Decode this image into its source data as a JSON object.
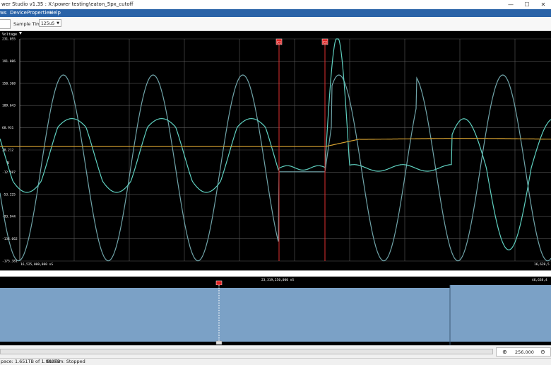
{
  "window": {
    "title": "wer Studio v1.35 : X:\\power testing\\eaton_5px_cutoff",
    "controls": [
      "—",
      "☐",
      "✕"
    ]
  },
  "menu": [
    "ws",
    "Device",
    "Properties",
    "Help"
  ],
  "toolbar": {
    "sample_time_label": "Sample Time:",
    "sample_time_value": "125uS"
  },
  "chart_data": {
    "type": "line",
    "ylabel": "Voltage",
    "unit": "V",
    "y_ticks": [
      "231.055",
      "191.086",
      "150.368",
      "109.643",
      "68.931",
      "28.212",
      "-12.507",
      "-53.225",
      "-93.944",
      "-134.662",
      "-175.381"
    ],
    "ylim": [
      -175.381,
      231.055
    ],
    "x_start_label": "16,525,000,000 nS",
    "x_end_label": "16,628,5",
    "cursors": [
      {
        "label": "C1"
      },
      {
        "label": "C2"
      }
    ],
    "grid": true,
    "series": [
      {
        "color": "#6fa3a8"
      },
      {
        "color": "#5fd0c0"
      },
      {
        "color": "#d4a030"
      }
    ]
  },
  "overview": {
    "time_center": "23,319,250,000 nS",
    "time_right": "46,638,4",
    "fill_color": "#7ba1c6"
  },
  "zoom": {
    "value": "256.000"
  },
  "status": {
    "space": "pace: 1.651TB of 1.862TB",
    "stream": "Stream:  Stopped"
  }
}
